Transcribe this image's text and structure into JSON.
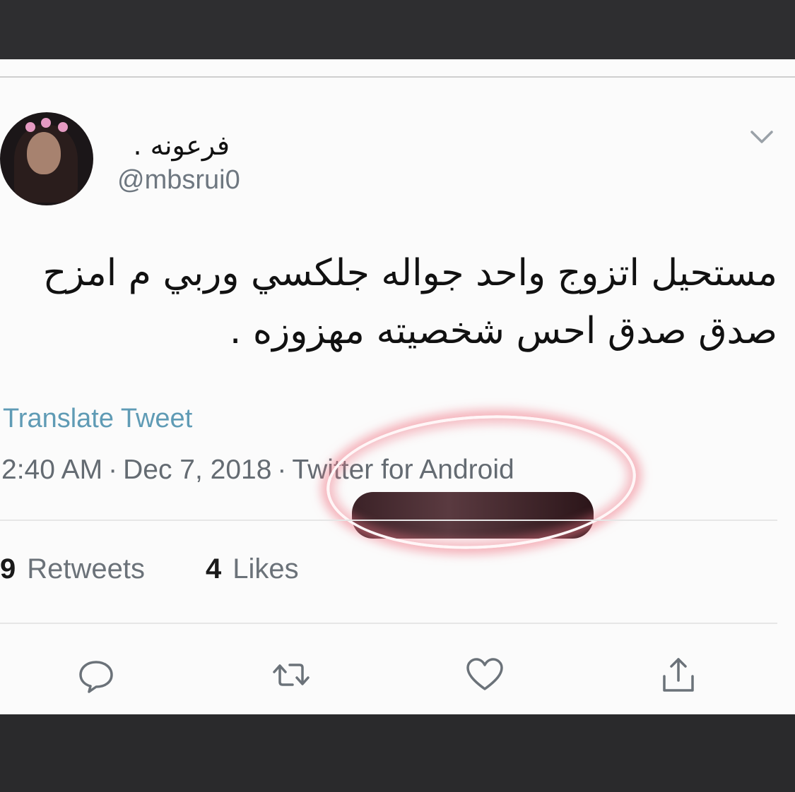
{
  "tweet": {
    "display_name": "فرعونه .",
    "handle": "@mbsrui0",
    "text_line1": "مستحيل اتزوج واحد جواله جلكسي وربي م امزح",
    "text_line2": "صدق صدق احس شخصيته مهزوزه .",
    "translate_label": "Translate Tweet",
    "time": "2:40 AM",
    "date": "Dec 7, 2018",
    "source": "Twitter for Android",
    "separator": "·",
    "retweets_count": "9",
    "retweets_label": "Retweets",
    "likes_count": "4",
    "likes_label": "Likes"
  },
  "icons": {
    "more": "chevron-down-icon",
    "reply": "comment-icon",
    "retweet": "retweet-icon",
    "like": "heart-icon",
    "share": "share-icon"
  },
  "colors": {
    "link": "#5f9bb5",
    "highlight_circle": "#f07887",
    "muted_text": "#646b72"
  }
}
